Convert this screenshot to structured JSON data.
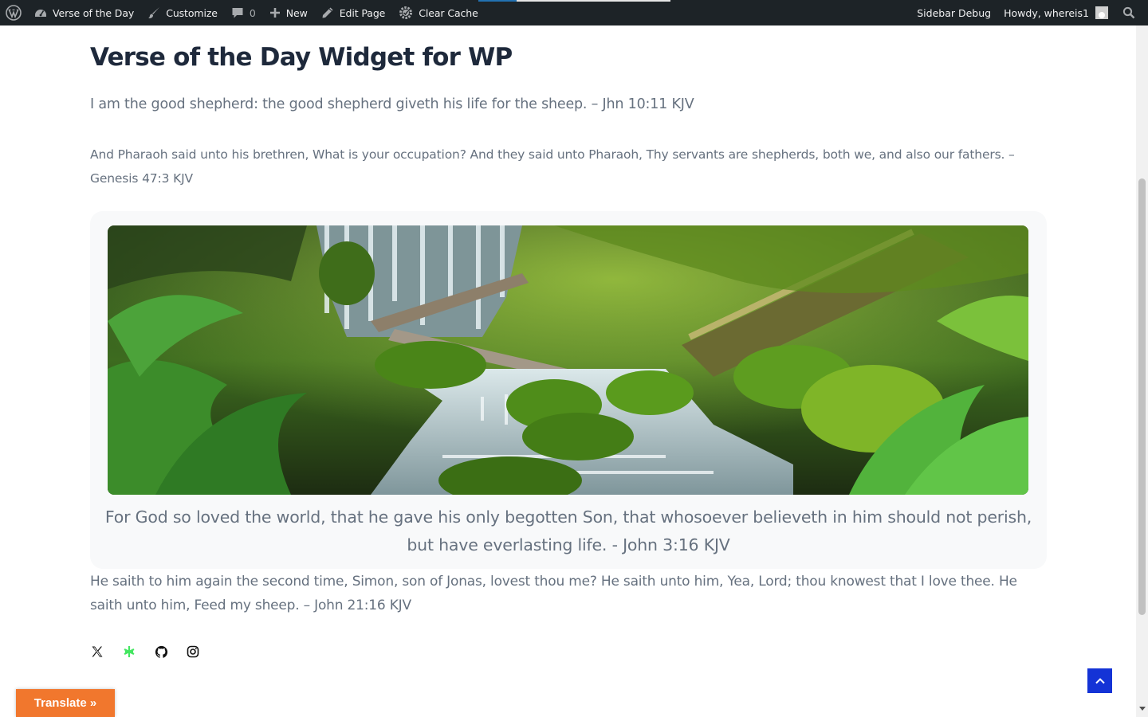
{
  "admin_bar": {
    "site_name": "Verse of the Day",
    "customize": "Customize",
    "comments_count": "0",
    "new": "New",
    "edit_page": "Edit Page",
    "clear_cache": "Clear Cache",
    "sidebar_debug": "Sidebar Debug",
    "howdy": "Howdy, whereis1"
  },
  "page": {
    "title": "Verse of the Day Widget for WP",
    "verse_1": "I am the good shepherd: the good shepherd giveth his life for the sheep. – Jhn 10:11 KJV",
    "verse_2": "And Pharaoh said unto his brethren, What is your occupation? And they said unto Pharaoh, Thy servants are shepherds, both we, and also our fathers. – Genesis 47:3 KJV",
    "widget_verse": "For God so loved the world, that he gave his only begotten Son, that whosoever believeth in him should not perish, but have everlasting life. - John 3:16 KJV",
    "verse_3": "He saith to him again the second time, Simon, son of Jonas, lovest thou me? He saith unto him, Yea, Lord; thou knowest that I love thee. He saith unto him, Feed my sheep. – John 21:16 KJV"
  },
  "social": [
    "x-icon",
    "linktree-icon",
    "github-icon",
    "instagram-icon"
  ],
  "translate_label": "Translate »",
  "colors": {
    "admin_bar_bg": "#1d2327",
    "title": "#1e293b",
    "verse_text": "#66717f",
    "card_bg": "#f8f9fa",
    "back_to_top": "#1433d6",
    "translate": "#f1772d",
    "linktree": "#43e660"
  }
}
